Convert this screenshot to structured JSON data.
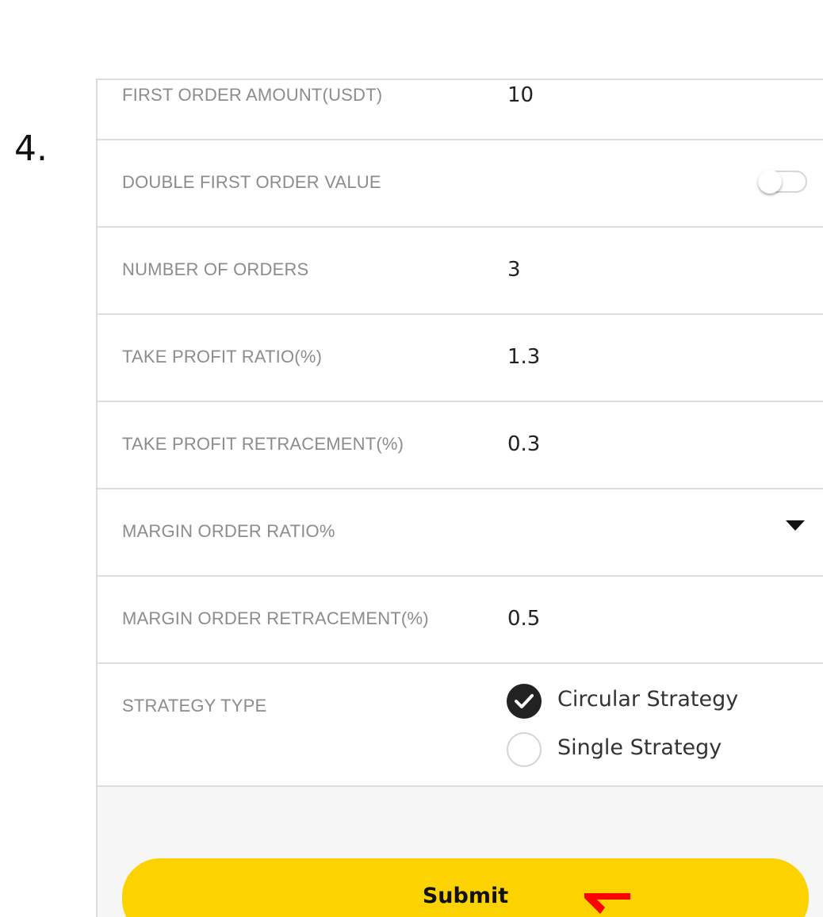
{
  "step_label": "4.",
  "form": {
    "first_order_amount": {
      "label": "FIRST ORDER AMOUNT(USDT)",
      "value": "10"
    },
    "double_first_order": {
      "label": "DOUBLE FIRST ORDER VALUE",
      "enabled": false
    },
    "number_of_orders": {
      "label": "NUMBER OF ORDERS",
      "value": "3"
    },
    "take_profit_ratio": {
      "label": "TAKE PROFIT RATIO(%)",
      "value": "1.3"
    },
    "take_profit_retracement": {
      "label": "TAKE PROFIT RETRACEMENT(%)",
      "value": "0.3"
    },
    "margin_order_ratio": {
      "label": "MARGIN ORDER RATIO%",
      "value": ""
    },
    "margin_order_retracement": {
      "label": "MARGIN ORDER RETRACEMENT(%)",
      "value": "0.5"
    },
    "strategy_type": {
      "label": "STRATEGY TYPE",
      "options": [
        {
          "label": "Circular Strategy",
          "selected": true
        },
        {
          "label": "Single Strategy",
          "selected": false
        }
      ]
    }
  },
  "submit_label": "Submit",
  "colors": {
    "accent": "#fcd200",
    "annotation_arrow": "#ff0000",
    "label_text": "#8c8c8c",
    "value_text": "#222222"
  },
  "icons": [
    "check-icon",
    "dropdown-caret-icon",
    "pointer-arrow-icon"
  ]
}
